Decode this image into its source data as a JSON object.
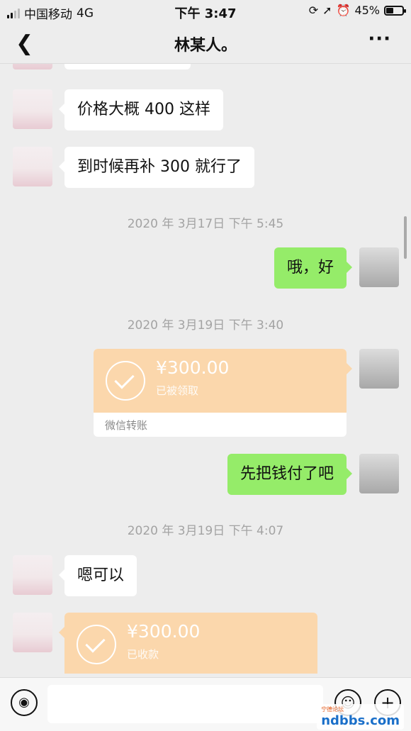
{
  "status_bar": {
    "carrier": "中国移动",
    "network": "4G",
    "time": "下午 3:47",
    "battery": "45%",
    "battery_level": 0.45
  },
  "nav": {
    "back_icon": "chevron-left",
    "title": "林某人。",
    "more_icon": "ellipsis"
  },
  "messages": [
    {
      "side": "in",
      "text": "价格大概 400 这样"
    },
    {
      "side": "in",
      "text": "到时候再补 300 就行了"
    },
    {
      "type": "timestamp",
      "text": "2020 年 3月17日 下午 5:45"
    },
    {
      "side": "out",
      "text": "哦，好"
    },
    {
      "type": "timestamp",
      "text": "2020 年 3月19日 下午 3:40"
    },
    {
      "type": "transfer",
      "side": "out",
      "amount": "¥300.00",
      "status": "已被领取",
      "footer": "微信转账"
    },
    {
      "side": "out",
      "text": "先把钱付了吧"
    },
    {
      "type": "timestamp",
      "text": "2020 年 3月19日 下午 4:07"
    },
    {
      "side": "in",
      "text": "嗯可以"
    },
    {
      "type": "transfer",
      "side": "in",
      "amount": "¥300.00",
      "status": "已收款"
    }
  ],
  "input_bar": {
    "voice_icon": "voice-icon",
    "emoji_icon": "emoji-icon",
    "plus_icon": "plus-icon"
  },
  "watermark": {
    "text": "ndbbs.com",
    "badge": "宁德论坛"
  },
  "colors": {
    "background": "#ededed",
    "outgoing_bubble": "#95ec69",
    "incoming_bubble": "#ffffff",
    "transfer": "#fbd7ac"
  }
}
